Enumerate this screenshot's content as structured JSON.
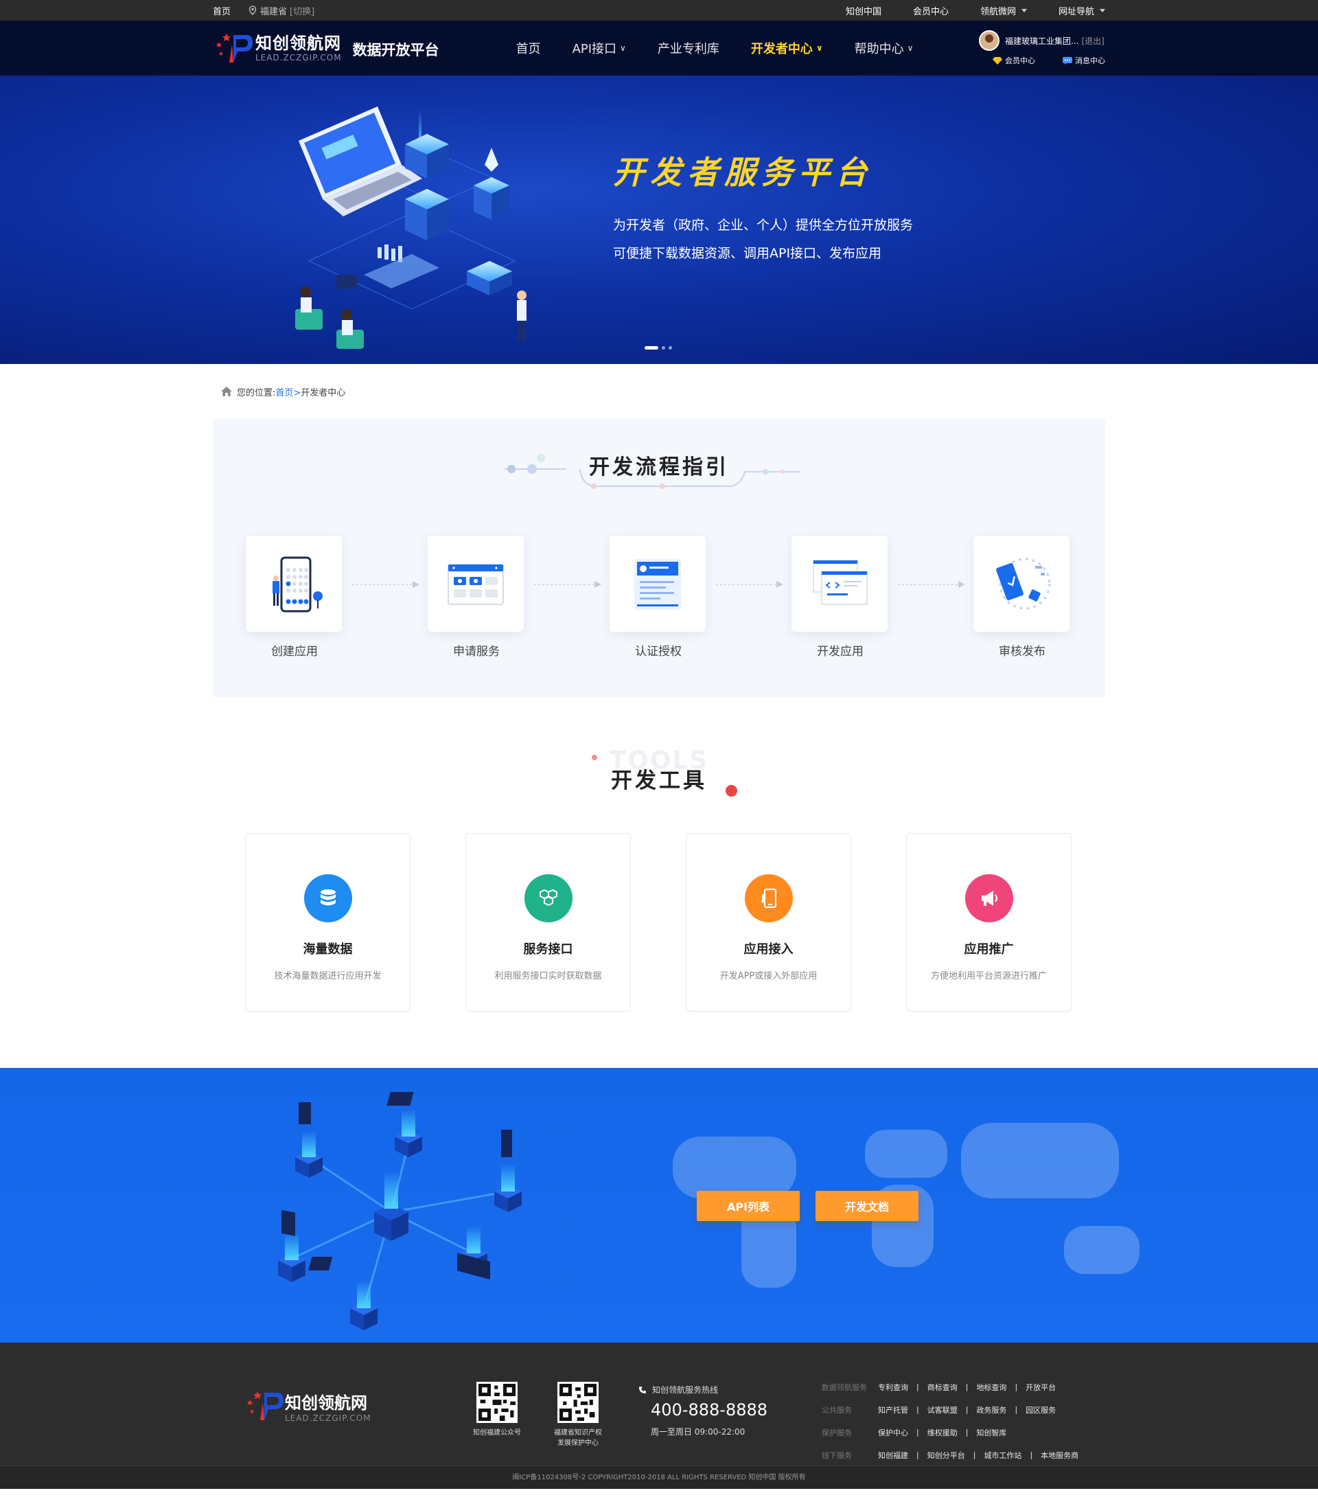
{
  "topbar": {
    "home": "首页",
    "location": "福建省",
    "switch": "[切换]",
    "right_links": [
      "知创中国",
      "会员中心",
      "领航微网",
      "网址导航"
    ]
  },
  "header": {
    "logo_cn": "知创领航网",
    "logo_en": "LEAD.ZCZGIP.COM",
    "platform": "数据开放平台",
    "nav": [
      {
        "label": "首页"
      },
      {
        "label": "API接口"
      },
      {
        "label": "产业专利库"
      },
      {
        "label": "开发者中心"
      },
      {
        "label": "帮助中心"
      }
    ],
    "user_name": "福建玻璃工业集团...",
    "logout": "[退出]",
    "member_center": "会员中心",
    "message_center": "消息中心"
  },
  "banner": {
    "headline": "开发者服务平台",
    "line1": "为开发者（政府、企业、个人）提供全方位开放服务",
    "line2": "可便捷下载数据资源、调用API接口、发布应用"
  },
  "breadcrumb": {
    "prefix": "您的位置:",
    "home": "首页>",
    "current": "开发者中心"
  },
  "flow": {
    "title": "开发流程指引",
    "steps": [
      {
        "label": "创建应用"
      },
      {
        "label": "申请服务"
      },
      {
        "label": "认证授权"
      },
      {
        "label": "开发应用"
      },
      {
        "label": "审核发布"
      }
    ]
  },
  "tools": {
    "bg_word": "TOOLS",
    "title": "开发工具",
    "items": [
      {
        "name": "海量数据",
        "desc": "技术海量数据进行应用开发",
        "color": "#1e8cf0"
      },
      {
        "name": "服务接口",
        "desc": "利用服务接口实时获取数据",
        "color": "#20b28a"
      },
      {
        "name": "应用接入",
        "desc": "开发APP或接入外部应用",
        "color": "#ff8a1e"
      },
      {
        "name": "应用推广",
        "desc": "方便地利用平台资源进行推广",
        "color": "#f0457a"
      }
    ]
  },
  "cta": {
    "api_list": "API列表",
    "dev_docs": "开发文档"
  },
  "footer": {
    "logo_cn": "知创领航网",
    "logo_en": "LEAD.ZCZGIP.COM",
    "qr1": "知创福建公众号",
    "qr2_line1": "福建省知识产权",
    "qr2_line2": "发展保护中心",
    "hotline_title": "知创领航服务热线",
    "hotline": "400-888-8888",
    "hours": "周一至周日 09:00-22:00",
    "link_rows": [
      {
        "cat": "数据领航服务",
        "items": [
          "专利查询",
          "商标查询",
          "地标查询",
          "开放平台"
        ]
      },
      {
        "cat": "公共服务",
        "items": [
          "知产托管",
          "试客联盟",
          "政务服务",
          "园区服务"
        ]
      },
      {
        "cat": "保护服务",
        "items": [
          "保护中心",
          "维权援助",
          "知创智库"
        ]
      },
      {
        "cat": "线下服务",
        "items": [
          "知创福建",
          "知创分平台",
          "城市工作站",
          "本地服务商"
        ]
      }
    ],
    "copyright": "闽ICP备11024308号-2 COPYRIGHT2010-2018 ALL RIGHTS RESERVED 知创中国 版权所有"
  },
  "colors": {
    "accent_yellow": "#ffd52a",
    "brand_blue": "#1a6cee",
    "cta_orange": "#ff9a2e",
    "header_bg": "#050d2c"
  }
}
